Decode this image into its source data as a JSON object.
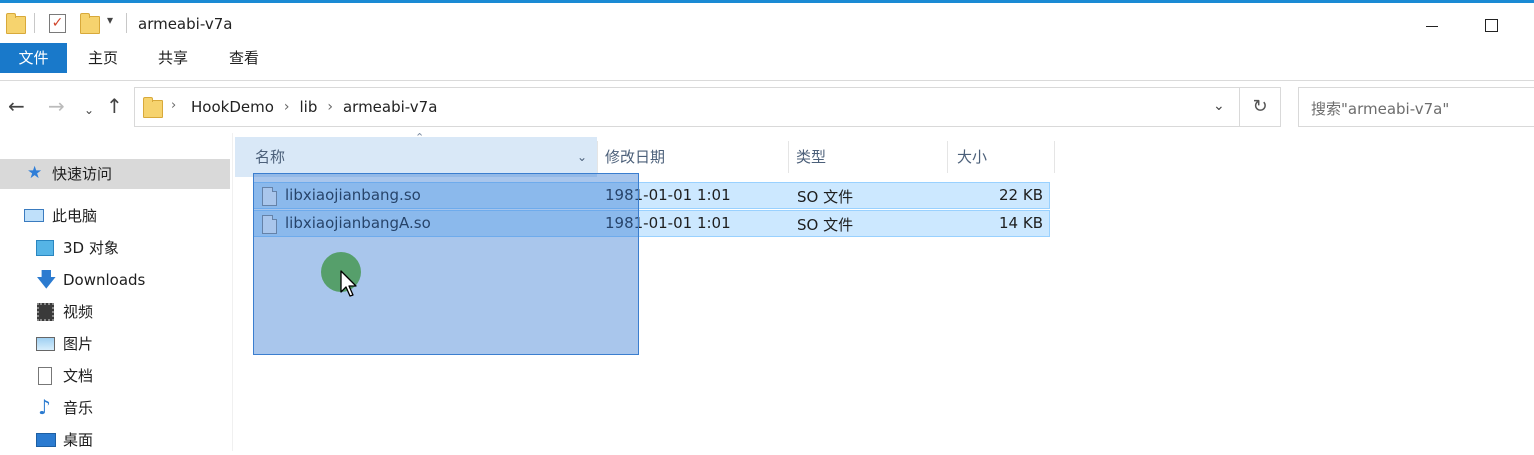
{
  "window": {
    "title": "armeabi-v7a"
  },
  "ribbon": {
    "tabs": [
      "文件",
      "主页",
      "共享",
      "查看"
    ]
  },
  "address": {
    "breadcrumb": [
      "HookDemo",
      "lib",
      "armeabi-v7a"
    ],
    "search_placeholder": "搜索\"armeabi-v7a\""
  },
  "sidebar": {
    "items": [
      {
        "label": "快速访问",
        "icon": "star-icon",
        "selected": true
      },
      {
        "label": "此电脑",
        "icon": "computer-icon"
      },
      {
        "label": "3D 对象",
        "icon": "cube-icon"
      },
      {
        "label": "Downloads",
        "icon": "download-arrow-icon"
      },
      {
        "label": "视频",
        "icon": "film-icon"
      },
      {
        "label": "图片",
        "icon": "picture-icon"
      },
      {
        "label": "文档",
        "icon": "document-icon"
      },
      {
        "label": "音乐",
        "icon": "music-note-icon"
      },
      {
        "label": "桌面",
        "icon": "desktop-icon"
      }
    ]
  },
  "columns": {
    "name": "名称",
    "date": "修改日期",
    "type": "类型",
    "size": "大小"
  },
  "files": [
    {
      "name": "libxiaojianbang.so",
      "date": "1981-01-01 1:01",
      "type": "SO 文件",
      "size": "22 KB",
      "selected": true
    },
    {
      "name": "libxiaojianbangA.so",
      "date": "1981-01-01 1:01",
      "type": "SO 文件",
      "size": "14 KB",
      "selected": true
    }
  ],
  "colors": {
    "accent": "#1979ca",
    "selection_fill": "#cce8ff",
    "selection_border": "#99d1ff",
    "marquee": "#3b7ecf"
  }
}
